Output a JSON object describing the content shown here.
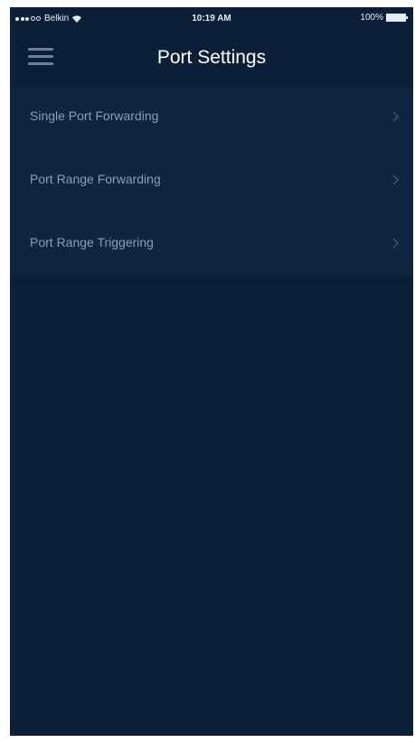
{
  "status_bar": {
    "carrier": "Belkin",
    "time": "10:19 AM",
    "battery": "100%",
    "icons": [
      "signal-icon",
      "wifi-icon",
      "battery-icon"
    ]
  },
  "header": {
    "title": "Port Settings",
    "menu_icon": "hamburger-menu-icon"
  },
  "settings": {
    "items": [
      {
        "label": "Single Port Forwarding",
        "icon": "chevron-right-icon"
      },
      {
        "label": "Port Range Forwarding",
        "icon": "chevron-right-icon"
      },
      {
        "label": "Port Range Triggering",
        "icon": "chevron-right-icon"
      }
    ]
  },
  "colors": {
    "background": "#0b1f38",
    "list_item_background": "#0f2641",
    "title_text": "#ffffff",
    "item_text": "#8e9db0",
    "menu_icon": "#6f8196"
  }
}
